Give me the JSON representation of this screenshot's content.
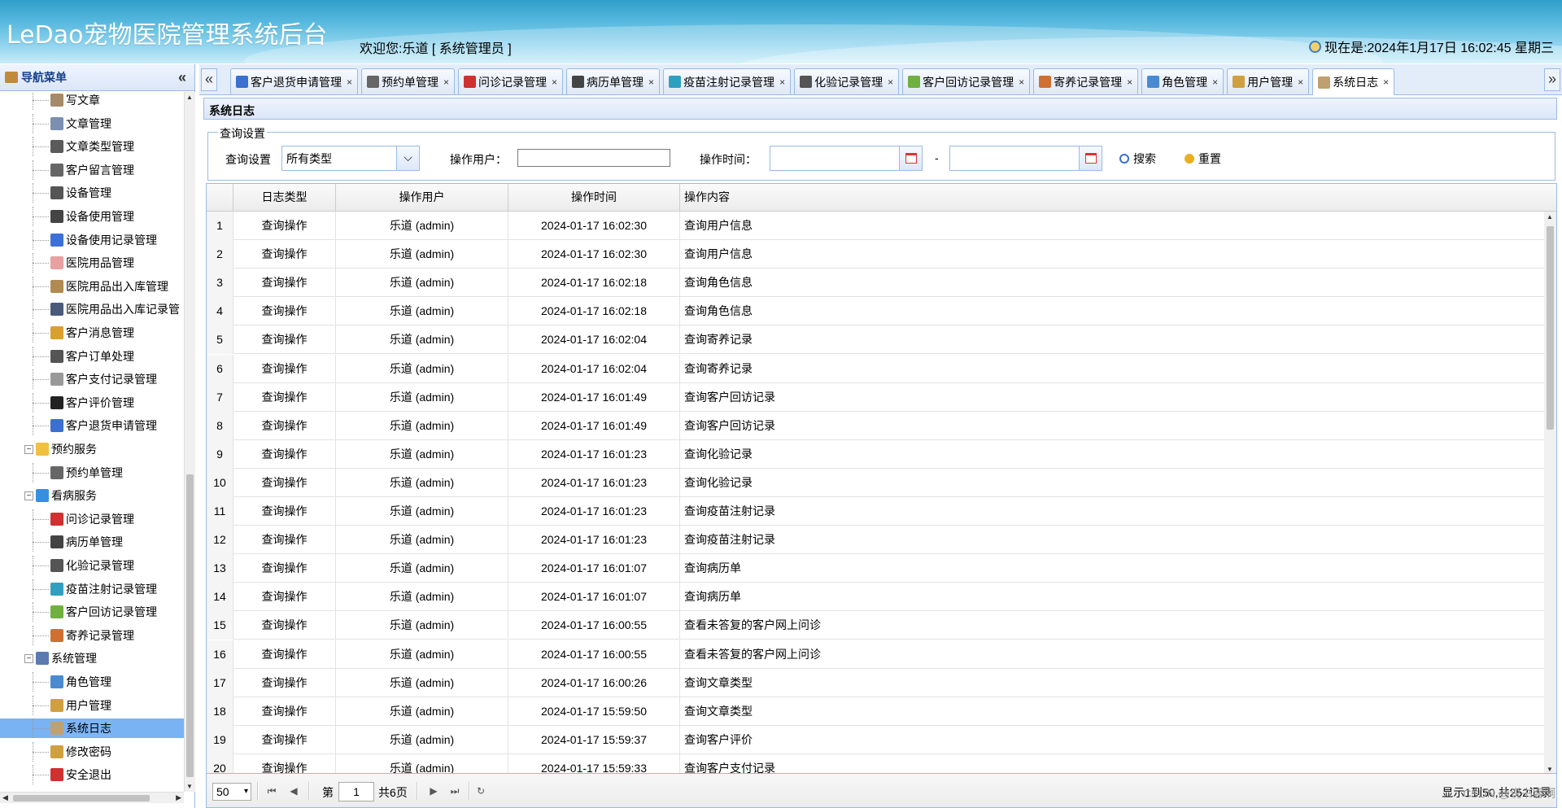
{
  "header": {
    "app_title": "LeDao宠物医院管理系统后台",
    "welcome": "欢迎您:乐道 [ 系统管理员 ]",
    "clock": "现在是:2024年1月17日 16:02:45 星期三"
  },
  "nav": {
    "title": "导航菜单",
    "collapse": "«",
    "items": [
      {
        "label": "写文章",
        "type": "child",
        "icon": "write-icon",
        "color": "#a58a6a"
      },
      {
        "label": "文章管理",
        "type": "child",
        "icon": "document-icon",
        "color": "#7b8fb0"
      },
      {
        "label": "文章类型管理",
        "type": "child",
        "icon": "document-type-icon",
        "color": "#5a5a5a"
      },
      {
        "label": "客户留言管理",
        "type": "child",
        "icon": "message-icon",
        "color": "#666666"
      },
      {
        "label": "设备管理",
        "type": "child",
        "icon": "device-icon",
        "color": "#555555"
      },
      {
        "label": "设备使用管理",
        "type": "child",
        "icon": "device-use-icon",
        "color": "#444444"
      },
      {
        "label": "设备使用记录管理",
        "type": "child",
        "icon": "device-record-icon",
        "color": "#3d6fd8"
      },
      {
        "label": "医院用品管理",
        "type": "child",
        "icon": "supplies-icon",
        "color": "#e8a0a0"
      },
      {
        "label": "医院用品出入库管理",
        "type": "child",
        "icon": "stock-icon",
        "color": "#b08a50"
      },
      {
        "label": "医院用品出入库记录管",
        "type": "child",
        "icon": "stock-record-icon",
        "color": "#4a5a7a"
      },
      {
        "label": "客户消息管理",
        "type": "child",
        "icon": "customer-message-icon",
        "color": "#d9a030"
      },
      {
        "label": "客户订单处理",
        "type": "child",
        "icon": "order-icon",
        "color": "#555555"
      },
      {
        "label": "客户支付记录管理",
        "type": "child",
        "icon": "payment-icon",
        "color": "#999999"
      },
      {
        "label": "客户评价管理",
        "type": "child",
        "icon": "thumbs-up-icon",
        "color": "#222222"
      },
      {
        "label": "客户退货申请管理",
        "type": "child",
        "icon": "grid-icon",
        "color": "#3b6fd0"
      },
      {
        "label": "预约服务",
        "type": "group",
        "icon": "folder-icon",
        "color": "#f0c040"
      },
      {
        "label": "预约单管理",
        "type": "child",
        "icon": "appointment-icon",
        "color": "#666666"
      },
      {
        "label": "看病服务",
        "type": "group",
        "icon": "medical-icon",
        "color": "#3a8ee0"
      },
      {
        "label": "问诊记录管理",
        "type": "child",
        "icon": "consult-icon",
        "color": "#d03030"
      },
      {
        "label": "病历单管理",
        "type": "child",
        "icon": "medical-record-icon",
        "color": "#444444"
      },
      {
        "label": "化验记录管理",
        "type": "child",
        "icon": "microscope-icon",
        "color": "#555555"
      },
      {
        "label": "疫苗注射记录管理",
        "type": "child",
        "icon": "syringe-icon",
        "color": "#30a0c0"
      },
      {
        "label": "客户回访记录管理",
        "type": "child",
        "icon": "revisit-icon",
        "color": "#70b040"
      },
      {
        "label": "寄养记录管理",
        "type": "child",
        "icon": "house-icon",
        "color": "#d07030"
      },
      {
        "label": "系统管理",
        "type": "group",
        "icon": "system-icon",
        "color": "#5a7ab0"
      },
      {
        "label": "角色管理",
        "type": "child",
        "icon": "role-icon",
        "color": "#4a8ad0"
      },
      {
        "label": "用户管理",
        "type": "child",
        "icon": "users-icon",
        "color": "#d0a040"
      },
      {
        "label": "系统日志",
        "type": "child",
        "icon": "log-icon",
        "color": "#c0a070",
        "selected": true
      },
      {
        "label": "修改密码",
        "type": "child",
        "icon": "password-icon",
        "color": "#d0a040"
      },
      {
        "label": "安全退出",
        "type": "child",
        "icon": "logout-icon",
        "color": "#d03030"
      }
    ]
  },
  "tabs": {
    "prev": "«",
    "next": "»",
    "items": [
      {
        "label": "客户退货申请管理",
        "icon": "grid-icon",
        "color": "#3b6fd0"
      },
      {
        "label": "预约单管理",
        "icon": "appointment-icon",
        "color": "#666666"
      },
      {
        "label": "问诊记录管理",
        "icon": "consult-icon",
        "color": "#d03030"
      },
      {
        "label": "病历单管理",
        "icon": "medical-record-icon",
        "color": "#444444"
      },
      {
        "label": "疫苗注射记录管理",
        "icon": "syringe-icon",
        "color": "#30a0c0"
      },
      {
        "label": "化验记录管理",
        "icon": "microscope-icon",
        "color": "#555555"
      },
      {
        "label": "客户回访记录管理",
        "icon": "revisit-icon",
        "color": "#70b040"
      },
      {
        "label": "寄养记录管理",
        "icon": "house-icon",
        "color": "#d07030"
      },
      {
        "label": "角色管理",
        "icon": "role-icon",
        "color": "#4a8ad0"
      },
      {
        "label": "用户管理",
        "icon": "users-icon",
        "color": "#d0a040"
      },
      {
        "label": "系统日志",
        "icon": "log-icon",
        "color": "#c0a070",
        "active": true
      }
    ],
    "close": "×"
  },
  "panel": {
    "title": "系统日志"
  },
  "query": {
    "legend": "查询设置",
    "type_label": "查询设置",
    "type_value": "所有类型",
    "user_label": "操作用户：",
    "user_value": "",
    "time_label": "操作时间：",
    "time_from": "",
    "time_to": "",
    "dash": "-",
    "search": "搜索",
    "reset": "重置"
  },
  "grid": {
    "columns": [
      "日志类型",
      "操作用户",
      "操作时间",
      "操作内容"
    ],
    "rows": [
      [
        "1",
        "查询操作",
        "乐道 (admin)",
        "2024-01-17 16:02:30",
        "查询用户信息"
      ],
      [
        "2",
        "查询操作",
        "乐道 (admin)",
        "2024-01-17 16:02:30",
        "查询用户信息"
      ],
      [
        "3",
        "查询操作",
        "乐道 (admin)",
        "2024-01-17 16:02:18",
        "查询角色信息"
      ],
      [
        "4",
        "查询操作",
        "乐道 (admin)",
        "2024-01-17 16:02:18",
        "查询角色信息"
      ],
      [
        "5",
        "查询操作",
        "乐道 (admin)",
        "2024-01-17 16:02:04",
        "查询寄养记录"
      ],
      [
        "6",
        "查询操作",
        "乐道 (admin)",
        "2024-01-17 16:02:04",
        "查询寄养记录"
      ],
      [
        "7",
        "查询操作",
        "乐道 (admin)",
        "2024-01-17 16:01:49",
        "查询客户回访记录"
      ],
      [
        "8",
        "查询操作",
        "乐道 (admin)",
        "2024-01-17 16:01:49",
        "查询客户回访记录"
      ],
      [
        "9",
        "查询操作",
        "乐道 (admin)",
        "2024-01-17 16:01:23",
        "查询化验记录"
      ],
      [
        "10",
        "查询操作",
        "乐道 (admin)",
        "2024-01-17 16:01:23",
        "查询化验记录"
      ],
      [
        "11",
        "查询操作",
        "乐道 (admin)",
        "2024-01-17 16:01:23",
        "查询疫苗注射记录"
      ],
      [
        "12",
        "查询操作",
        "乐道 (admin)",
        "2024-01-17 16:01:23",
        "查询疫苗注射记录"
      ],
      [
        "13",
        "查询操作",
        "乐道 (admin)",
        "2024-01-17 16:01:07",
        "查询病历单"
      ],
      [
        "14",
        "查询操作",
        "乐道 (admin)",
        "2024-01-17 16:01:07",
        "查询病历单"
      ],
      [
        "15",
        "查询操作",
        "乐道 (admin)",
        "2024-01-17 16:00:55",
        "查看未答复的客户网上问诊"
      ],
      [
        "16",
        "查询操作",
        "乐道 (admin)",
        "2024-01-17 16:00:55",
        "查看未答复的客户网上问诊"
      ],
      [
        "17",
        "查询操作",
        "乐道 (admin)",
        "2024-01-17 16:00:26",
        "查询文章类型"
      ],
      [
        "18",
        "查询操作",
        "乐道 (admin)",
        "2024-01-17 15:59:50",
        "查询文章类型"
      ],
      [
        "19",
        "查询操作",
        "乐道 (admin)",
        "2024-01-17 15:59:37",
        "查询客户评价"
      ],
      [
        "20",
        "查询操作",
        "乐道 (admin)",
        "2024-01-17 15:59:33",
        "查询客户支付记录"
      ]
    ]
  },
  "pager": {
    "page_size": "50",
    "page_label": "第",
    "page_value": "1",
    "total_pages": "共6页",
    "info": "显示1到50,共252记录"
  },
  "watermark": "CSDN @说书客啊"
}
